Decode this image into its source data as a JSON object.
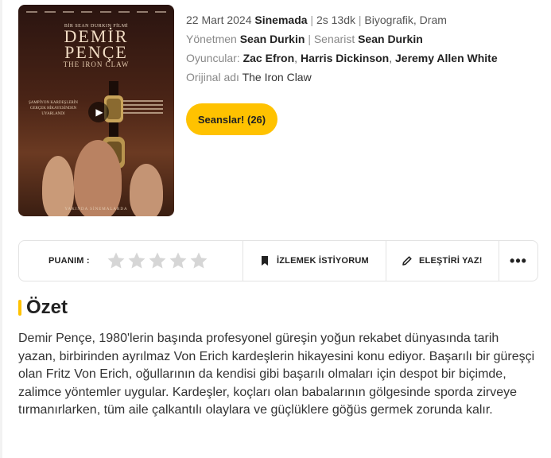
{
  "movie": {
    "poster": {
      "byline": "BİR SEAN DURKIN FİLMİ",
      "title_line1": "DEMİR",
      "title_line2": "PENÇE",
      "subtitle": "THE IRON CLAW",
      "tagline": "ŞAMPİYON KARDEŞLERİN GERÇEK HİKAYESİNDEN UYARLANDI",
      "release": "YAKINDA SİNEMALARDA"
    },
    "release_date": "22 Mart 2024",
    "release_status": "Sinemada",
    "duration": "2s 13dk",
    "genres": "Biyografik, Dram",
    "director_label": "Yönetmen",
    "director": "Sean Durkin",
    "writer_label": "Senarist",
    "writer": "Sean Durkin",
    "cast_label": "Oyuncular:",
    "cast": [
      "Zac Efron",
      "Harris Dickinson",
      "Jeremy Allen White"
    ],
    "original_title_label": "Orijinal adı",
    "original_title": "The Iron Claw",
    "showtimes_button": "Seanslar! (26)"
  },
  "actions": {
    "rating_label": "PUANIM :",
    "rating_value": 0,
    "rating_max": 5,
    "watchlist_label": "İZLEMEK İSTİYORUM",
    "review_label": "ELEŞTİRİ YAZ!",
    "more_label": "•••"
  },
  "summary": {
    "heading": "Özet",
    "text": "Demir Pençe, 1980'lerin başında profesyonel güreşin yoğun rekabet dünyasında tarih yazan, birbirinden ayrılmaz Von Erich kardeşlerin hikayesini konu ediyor. Başarılı bir güreşçi olan Fritz Von Erich, oğullarının da kendisi gibi başarılı olmaları için despot bir biçimde, zalimce yöntemler uygular. Kardeşler, koçları olan babalarının gölgesinde sporda zirveye tırmanırlarken, tüm aile çalkantılı olaylara ve güçlüklere göğüs germek zorunda kalır."
  },
  "colors": {
    "accent": "#ffc200",
    "star_empty": "#d6d6d6"
  }
}
